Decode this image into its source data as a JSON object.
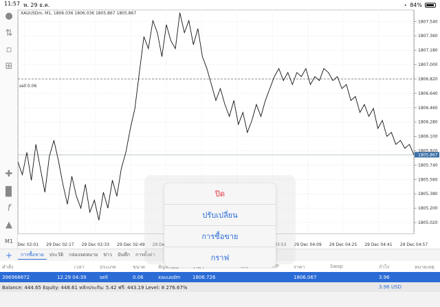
{
  "status": {
    "time": "11:57",
    "date": "พ. 29 ธ.ค.",
    "battery": "84%"
  },
  "chart": {
    "header": "XAUUSDm, M1, 1806.036 1806.036 1805.867 1805.867",
    "sell_label": "sell 0.06",
    "current_price": "1805.867",
    "timeframe": "M1"
  },
  "chart_data": {
    "type": "line",
    "title": "XAUUSDm, M1, 1806.036 1806.036 1805.867 1805.867",
    "xlabel": "",
    "ylabel": "",
    "ylim": [
      1804.9,
      1807.62
    ],
    "y_ticks": [
      "1807.540",
      "1807.360",
      "1807.180",
      "1807.000",
      "1806.820",
      "1806.640",
      "1806.460",
      "1806.280",
      "1806.100",
      "1805.920",
      "1805.740",
      "1805.560",
      "1805.380",
      "1805.200",
      "1805.020"
    ],
    "x_ticks": [
      "29 Dec 02:01",
      "29 Dec 02:17",
      "29 Dec 02:33",
      "29 Dec 02:49",
      "29 Dec 03:05",
      "29 Dec 03:21",
      "29 Dec 03:37",
      "29 Dec 03:53",
      "29 Dec 04:09",
      "29 Dec 04:25",
      "29 Dec 04:41",
      "29 Dec 04:57"
    ],
    "x": [
      0,
      2,
      4,
      6,
      8,
      10,
      12,
      14,
      16,
      18,
      20,
      22,
      24,
      26,
      28,
      30,
      32,
      34,
      36,
      38,
      40,
      42,
      44,
      46,
      48,
      50,
      52,
      54,
      56,
      58,
      60,
      62,
      64,
      66,
      68,
      70,
      72,
      74,
      76,
      78,
      80,
      82,
      84,
      86,
      88,
      90,
      92,
      94,
      96,
      98,
      100,
      102,
      104,
      106,
      108,
      110,
      112,
      114,
      116,
      118,
      120,
      122,
      124,
      126,
      128,
      130,
      132,
      134,
      136,
      138,
      140,
      142,
      144,
      146,
      148,
      150,
      152,
      154,
      156,
      158,
      160,
      162,
      164,
      166,
      168,
      170,
      172,
      174,
      176
    ],
    "values": [
      1805.78,
      1805.62,
      1805.9,
      1805.55,
      1806.0,
      1805.7,
      1805.4,
      1805.85,
      1806.05,
      1805.8,
      1805.5,
      1805.25,
      1805.6,
      1805.35,
      1805.2,
      1805.5,
      1805.15,
      1805.3,
      1805.05,
      1805.4,
      1805.2,
      1805.55,
      1805.35,
      1805.7,
      1805.9,
      1806.2,
      1806.45,
      1806.9,
      1807.35,
      1807.2,
      1807.55,
      1807.4,
      1807.1,
      1807.5,
      1807.3,
      1807.2,
      1807.65,
      1807.4,
      1807.55,
      1807.25,
      1807.45,
      1807.1,
      1806.95,
      1806.75,
      1806.55,
      1806.7,
      1806.5,
      1806.35,
      1806.55,
      1806.25,
      1806.4,
      1806.15,
      1806.3,
      1806.5,
      1806.35,
      1806.55,
      1806.7,
      1806.85,
      1806.95,
      1806.8,
      1806.9,
      1806.75,
      1806.9,
      1806.85,
      1806.95,
      1806.75,
      1806.85,
      1806.8,
      1806.95,
      1806.9,
      1806.8,
      1806.85,
      1806.7,
      1806.75,
      1806.55,
      1806.6,
      1806.4,
      1806.5,
      1806.35,
      1806.45,
      1806.2,
      1806.3,
      1806.1,
      1806.15,
      1806.0,
      1806.05,
      1805.95,
      1806.0,
      1805.87
    ],
    "hlines": [
      {
        "label": "sell 0.06",
        "value": 1806.82
      }
    ],
    "grid": true
  },
  "sidebar": {
    "m1": "M1"
  },
  "tabs": {
    "items": [
      "การซื้อขาย",
      "ประวัติ",
      "กล่องจดหมาย",
      "ข่าว",
      "บันทึก",
      "การตั้งค่า"
    ]
  },
  "table": {
    "headers": [
      "คำสั่ง",
      "เวลา",
      "ประเภท",
      "ขนาด",
      "สัญลักษณ์",
      "ราคา",
      "S/L",
      "T/P",
      "ราคา",
      "Swap",
      "กำไร",
      "หมายเหตุ"
    ],
    "row": [
      "396968672",
      "12.29 04:39",
      "sell",
      "0.06",
      "xauusdm",
      "1806.726",
      "",
      "",
      "1806.067",
      "",
      "3.96",
      ""
    ]
  },
  "balance": {
    "text": "Balance: 444.65 Equity: 448.61 หลักประกัน: 5.42 ฟรี: 443.19 Level: 8 276.67%",
    "profit": "3.96",
    "currency": "USD"
  },
  "popup": {
    "items": [
      "ปิด",
      "ปรับเปลี่ยน",
      "การซื้อขาย",
      "กราฟ"
    ]
  }
}
